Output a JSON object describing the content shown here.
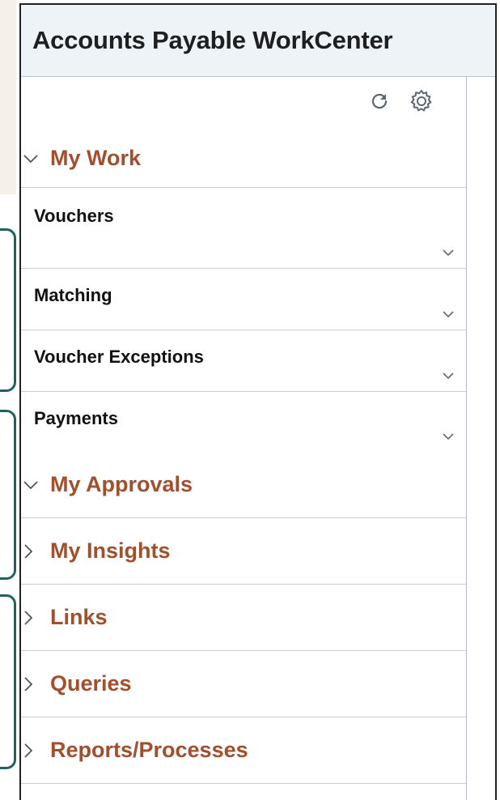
{
  "panel": {
    "title": "Accounts Payable WorkCenter"
  },
  "toolbar": {
    "refresh_icon": "refresh-icon",
    "settings_icon": "gear-icon"
  },
  "sections": {
    "my_work": {
      "label": "My Work",
      "expanded": true
    },
    "my_approvals": {
      "label": "My Approvals",
      "expanded": true
    },
    "my_insights": {
      "label": "My Insights",
      "expanded": false
    },
    "links": {
      "label": "Links",
      "expanded": false
    },
    "queries": {
      "label": "Queries",
      "expanded": false
    },
    "reports": {
      "label": "Reports/Processes",
      "expanded": false
    }
  },
  "my_work_items": [
    {
      "label": "Vouchers"
    },
    {
      "label": "Matching"
    },
    {
      "label": "Voucher Exceptions"
    },
    {
      "label": "Payments"
    }
  ],
  "colors": {
    "section_label": "#a14f2c",
    "header_bg": "#eef3f7",
    "teal_outline": "#1e6360"
  }
}
